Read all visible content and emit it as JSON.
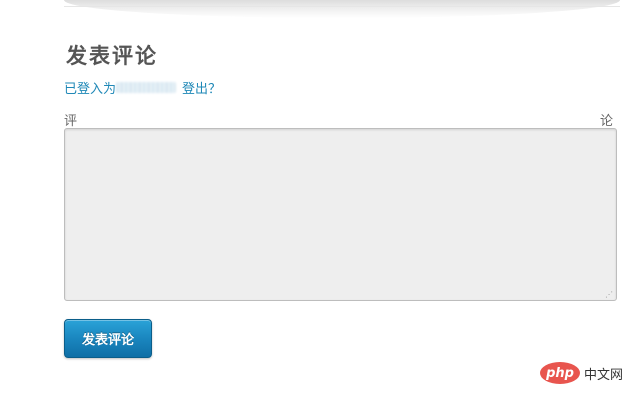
{
  "comment_form": {
    "heading": "发表评论",
    "logged_in_prefix": "已登入为",
    "logout_link": "登出？",
    "label_left": "评",
    "label_right": "论",
    "textarea_value": "",
    "submit_label": "发表评论"
  },
  "watermark": {
    "logo_text": "php",
    "site_text": "中文网"
  },
  "colors": {
    "link": "#1f88b7",
    "button": "#1a86bf",
    "textarea_bg": "#eeeeee",
    "watermark_logo": "#e8554e"
  }
}
